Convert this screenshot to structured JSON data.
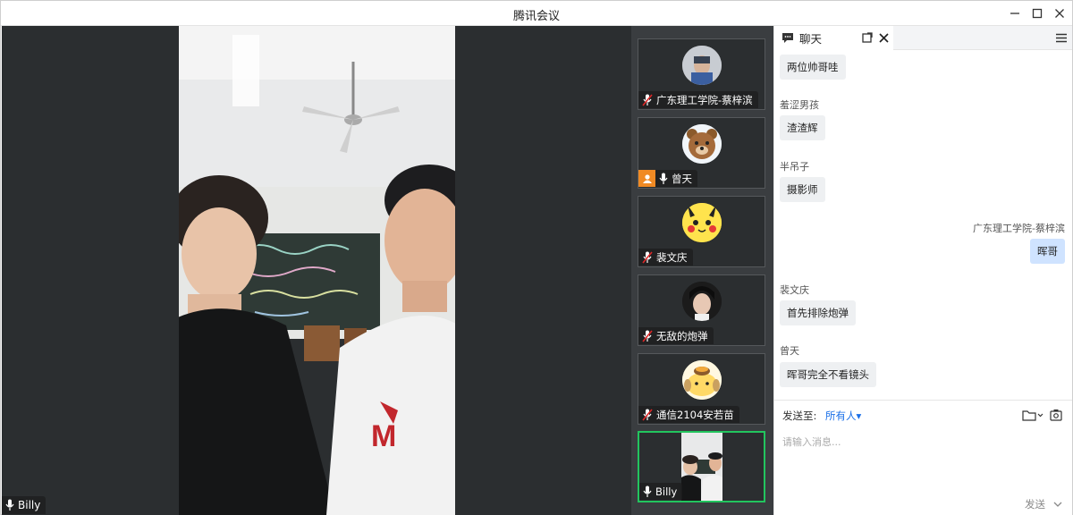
{
  "window": {
    "title": "腾讯会议"
  },
  "stage": {
    "speaker_name": "Billy"
  },
  "participants": [
    {
      "name": "广东理工学院-蔡梓滨",
      "avatar": "photo-avatar",
      "mic": "muted"
    },
    {
      "name": "曾天",
      "avatar": "bear-avatar",
      "mic": "on",
      "host": true
    },
    {
      "name": "裴文庆",
      "avatar": "pikachu-avatar",
      "mic": "muted"
    },
    {
      "name": "无敌的炮弹",
      "avatar": "portrait-avatar",
      "mic": "muted"
    },
    {
      "name": "通信2104安若苗",
      "avatar": "pompompurin-avatar",
      "mic": "muted"
    },
    {
      "name": "Billy",
      "avatar": "video",
      "mic": "on",
      "active": true
    }
  ],
  "chat": {
    "tab_label": "聊天",
    "messages": [
      {
        "sender": "",
        "text": "两位帅哥哇"
      },
      {
        "sender": "羞涩男孩",
        "text": "渣渣辉"
      },
      {
        "sender": "半吊子",
        "text": "摄影师"
      },
      {
        "sender": "广东理工学院-蔡梓滨",
        "text": "晖哥",
        "mine": true
      },
      {
        "sender": "裴文庆",
        "text": "首先排除炮弹"
      },
      {
        "sender": "曾天",
        "text": "晖哥完全不看镜头"
      }
    ],
    "send_to_label": "发送至:",
    "send_to_target": "所有人▾",
    "input_placeholder": "请输入消息...",
    "send_label": "发送"
  },
  "colors": {
    "active_border": "#22c55e",
    "link": "#1a6fe8",
    "host_badge": "#f08a24"
  }
}
